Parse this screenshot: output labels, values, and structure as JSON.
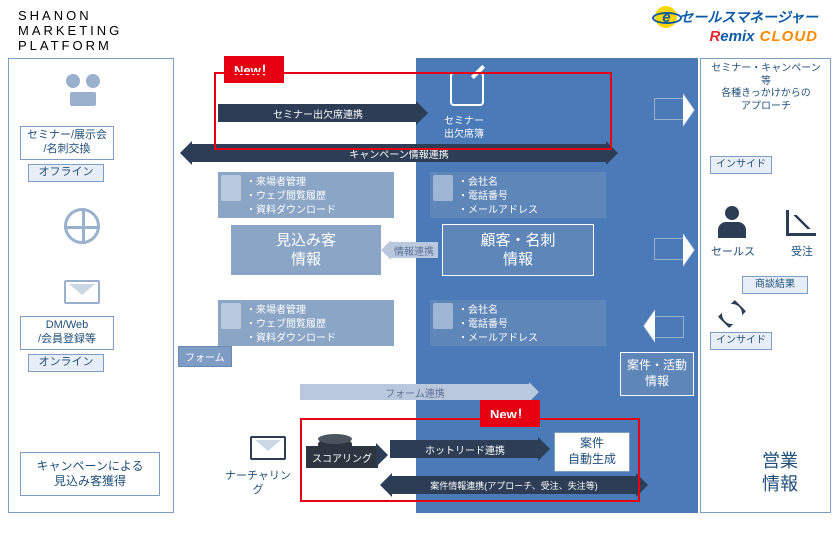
{
  "shanon": {
    "l1": "SHANON",
    "l2": "MARKETING",
    "l3": "PLATFORM"
  },
  "remix": {
    "line1": "セールスマネージャー",
    "brand_a": "R",
    "brand_b": "emix",
    "brand_c": " CLOUD"
  },
  "left": {
    "seminar": "セミナー/展示会\n/名刺交換",
    "offline": "オフライン",
    "dmweb": "DM/Web\n/会員登録等",
    "online": "オンライン",
    "campaign": "キャンペーンによる\n見込み客獲得"
  },
  "badges": {
    "new": "New！"
  },
  "arrows": {
    "seminar_att": "セミナー出欠席連携",
    "campaign_info": "キャンペーン情報連携",
    "info_link": "情報連携",
    "form_link": "フォーム連携",
    "hotlead": "ホットリード連携",
    "case_info": "案件情報連携(アプローチ、受注、失注等)"
  },
  "mid": {
    "form": "フォーム",
    "bullets1": "・来場者管理\n・ウェブ閲覧履歴\n・資料ダウンロード",
    "lead": "見込み客\n情報",
    "nurturing": "ナーチャリング",
    "scoring": "スコアリング"
  },
  "right": {
    "attbook": "セミナー\n出欠席簿",
    "bullets_client": "・会社名\n・電話番号\n・メールアドレス",
    "customer": "顧客・名刺\n情報",
    "case_auto": "案件\n自動生成",
    "case_activity": "案件・活動\n情報"
  },
  "sales": {
    "approach": "セミナー・キャンペーン等\n各種きっかけからの\nアプローチ",
    "inside": "インサイド",
    "sales_label": "セールス",
    "order": "受注",
    "negotiation": "商談結果",
    "sales_info": "営業\n情報"
  }
}
